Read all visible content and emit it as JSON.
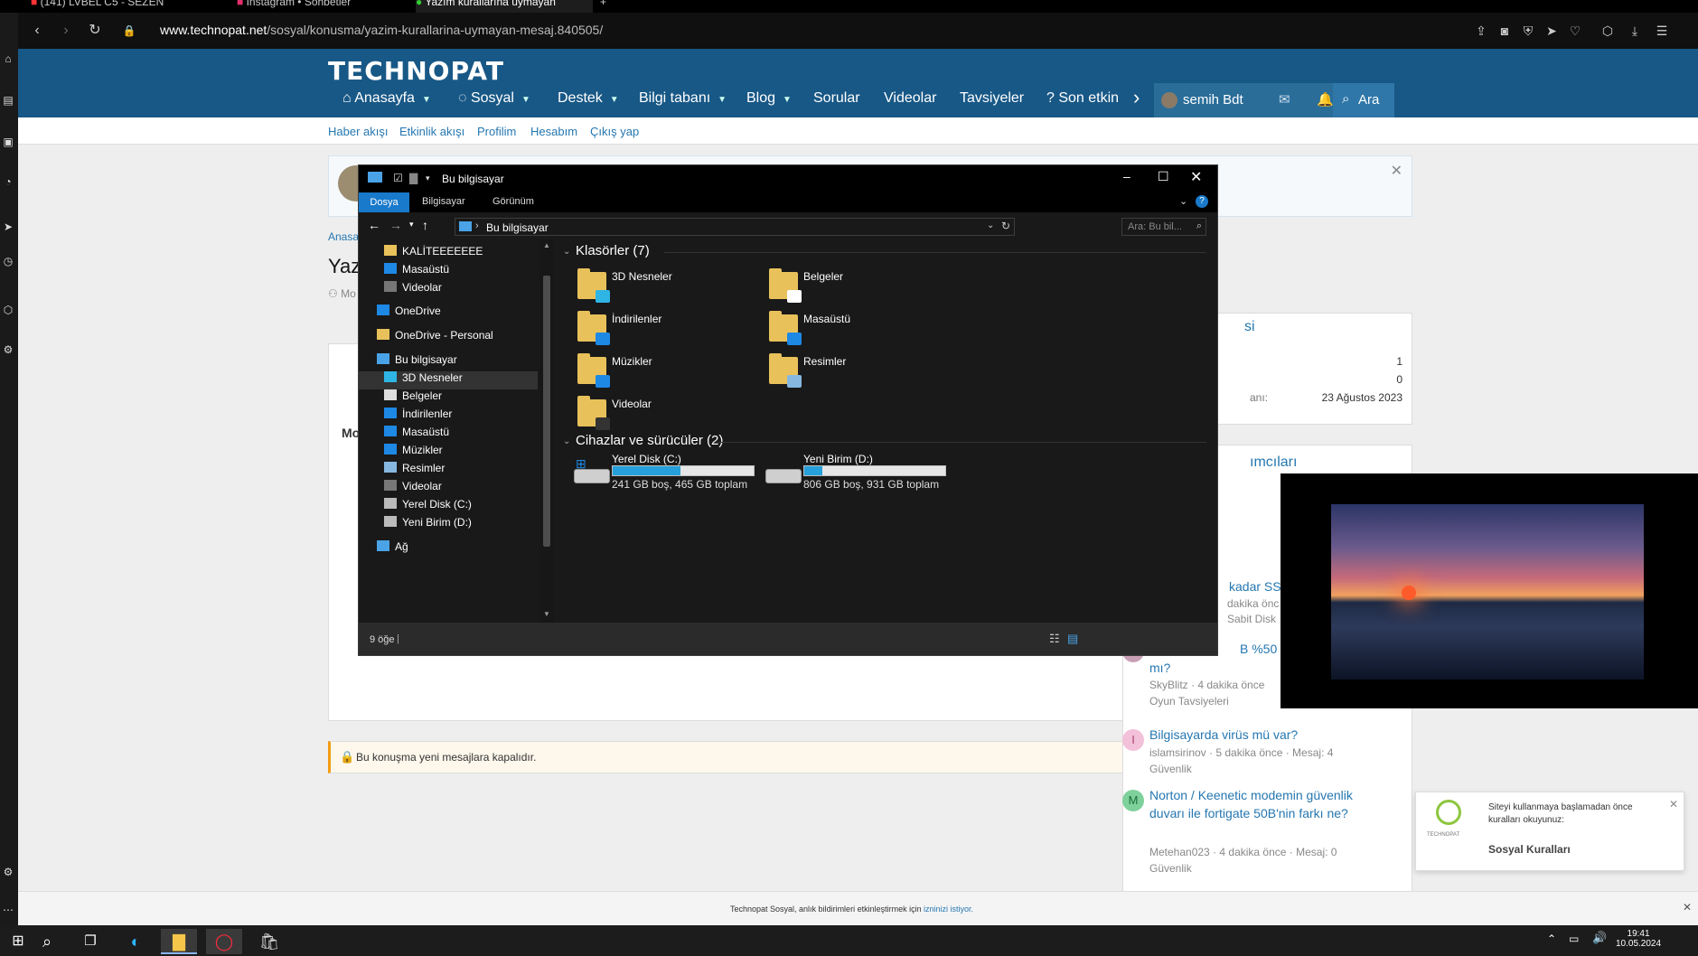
{
  "browser": {
    "tabs": [
      {
        "label": "(141) LVBEL C5 - SEZEN",
        "active": false
      },
      {
        "label": "Instagram • Sohbetler",
        "active": false
      },
      {
        "label": "Yazım kurallarına uymayan",
        "active": true
      }
    ],
    "new_tab": "+",
    "url_domain": "www.technopat.net",
    "url_path": "/sosyal/konusma/yazim-kurallarina-uymayan-mesaj.840505/"
  },
  "site": {
    "logo": "TECHNOPAT",
    "nav": [
      {
        "label": "Anasayfa",
        "caret": true
      },
      {
        "label": "Sosyal",
        "caret": true
      },
      {
        "label": "Destek",
        "caret": true
      },
      {
        "label": "Bilgi tabanı",
        "caret": true
      },
      {
        "label": "Blog",
        "caret": true
      },
      {
        "label": "Sorular",
        "caret": false
      },
      {
        "label": "Videolar",
        "caret": false
      },
      {
        "label": "Tavsiyeler",
        "caret": false
      },
      {
        "label": "Son etkin",
        "caret": false
      }
    ],
    "user_name": "semih Bdt",
    "search_label": "Ara",
    "subnav": [
      "Haber akışı",
      "Etkinlik akışı",
      "Profilim",
      "Hesabım",
      "Çıkış yap"
    ],
    "breadcrumb_partial": "Anasay",
    "page_title_partial": "Yazı",
    "meta_partial": "Mo",
    "body_partial": "Mo",
    "closed_notice": "Bu konuşma yeni mesajlara kapalıdır.",
    "sidebar_card1": {
      "title_partial": "si",
      "value1": "1",
      "value2": "0",
      "date_label_partial": "anı:",
      "date_value": "23 Ağustos 2023"
    },
    "sidebar_card2_title_partial": "ımcıları",
    "sidebar_threads_partial": [
      {
        "title": "kadar SS",
        "meta": "dakika önc",
        "cat": "Sabit Disk"
      },
      {
        "title": "B %50 in",
        "title2": "mı?",
        "meta": "SkyBlitz · 4 dakika önce",
        "cat": "Oyun Tavsiyeleri"
      }
    ],
    "threads": [
      {
        "avatar": "I",
        "avatar_color": "#f3c1d9",
        "title": "Bilgisayarda virüs mü var?",
        "meta": "islamsirinov · 5 dakika önce · Mesaj: 4",
        "cat": "Güvenlik"
      },
      {
        "avatar": "M",
        "avatar_color": "#7fd19b",
        "title": "Norton / Keenetic modemin güvenlik duvarı ile fortigate 50B'nin farkı ne?",
        "meta": "Metehan023 · 4 dakika önce · Mesaj: 0",
        "cat": "Güvenlik"
      }
    ],
    "toast": {
      "text": "Siteyi kullanmaya başlamadan önce kuralları okuyunuz:",
      "link": "Sosyal Kuralları",
      "logo_text": "TECHNOPAT"
    },
    "notif_text": "Technopat Sosyal, anlık bildirimleri etkinleştirmek için",
    "notif_link": "izninizi istiyor."
  },
  "explorer": {
    "title": "Bu bilgisayar",
    "ribbon_tabs": [
      "Dosya",
      "Bilgisayar",
      "Görünüm"
    ],
    "path": "Bu bilgisayar",
    "search_placeholder": "Ara: Bu bil...",
    "nav_items": [
      {
        "label": "KALİTEEEEEEE",
        "icon": "folder-icon",
        "indent": 1
      },
      {
        "label": "Masaüstü",
        "icon": "desktop-icon",
        "indent": 1
      },
      {
        "label": "Videolar",
        "icon": "video-icon",
        "indent": 1
      },
      {
        "label": "OneDrive",
        "icon": "cloud-icon",
        "indent": 0
      },
      {
        "label": "OneDrive - Personal",
        "icon": "folder-icon",
        "indent": 0
      },
      {
        "label": "Bu bilgisayar",
        "icon": "computer-icon",
        "indent": 0
      },
      {
        "label": "3D Nesneler",
        "icon": "cube-icon",
        "indent": 1
      },
      {
        "label": "Belgeler",
        "icon": "document-icon",
        "indent": 1
      },
      {
        "label": "İndirilenler",
        "icon": "download-icon",
        "indent": 1
      },
      {
        "label": "Masaüstü",
        "icon": "desktop-icon",
        "indent": 1
      },
      {
        "label": "Müzikler",
        "icon": "music-icon",
        "indent": 1
      },
      {
        "label": "Resimler",
        "icon": "picture-icon",
        "indent": 1
      },
      {
        "label": "Videolar",
        "icon": "video-icon",
        "indent": 1
      },
      {
        "label": "Yerel Disk (C:)",
        "icon": "drive-icon",
        "indent": 1
      },
      {
        "label": "Yeni Birim (D:)",
        "icon": "drive-icon",
        "indent": 1
      },
      {
        "label": "Ağ",
        "icon": "network-icon",
        "indent": 0
      }
    ],
    "folders_header": "Klasörler (7)",
    "folders": [
      {
        "label": "3D Nesneler",
        "badge": "#2fb5e5"
      },
      {
        "label": "Belgeler",
        "badge": "#ffffff"
      },
      {
        "label": "İndirilenler",
        "badge": "#1e88e5"
      },
      {
        "label": "Masaüstü",
        "badge": "#1e88e5"
      },
      {
        "label": "Müzikler",
        "badge": "#1e88e5"
      },
      {
        "label": "Resimler",
        "badge": "#86b8e0"
      },
      {
        "label": "Videolar",
        "badge": "#333333"
      }
    ],
    "devices_header": "Cihazlar ve sürücüler (2)",
    "drives": [
      {
        "label": "Yerel Disk (C:)",
        "detail": "241 GB boş, 465 GB toplam",
        "used_fraction": 0.48
      },
      {
        "label": "Yeni Birim (D:)",
        "detail": "806 GB boş, 931 GB toplam",
        "used_fraction": 0.13
      }
    ],
    "status": "9 öğe"
  },
  "taskbar": {
    "time": "19:41",
    "date": "10.05.2024"
  },
  "colors": {
    "site_header": "#185886",
    "link": "#2577b1",
    "explorer_accent": "#1979ca",
    "drive_bar": "#26a0da"
  }
}
